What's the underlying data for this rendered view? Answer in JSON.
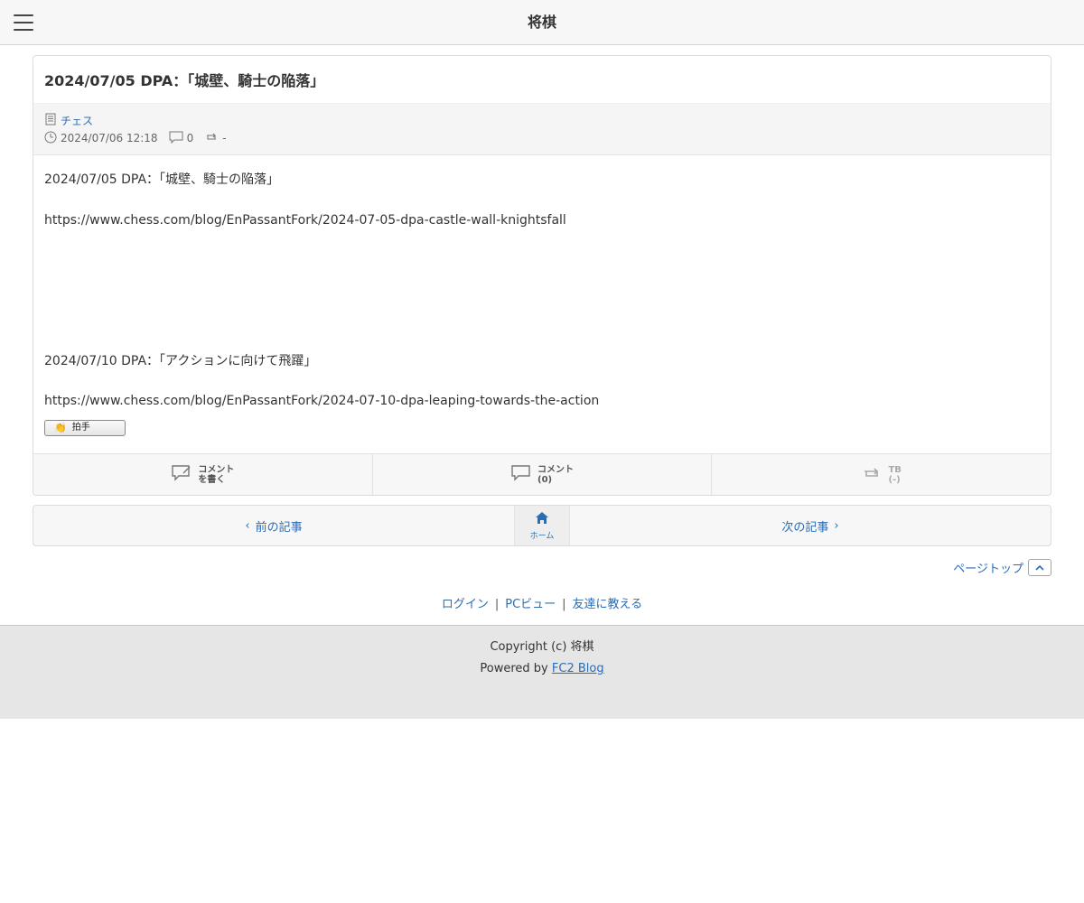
{
  "header": {
    "title": "将棋"
  },
  "entry": {
    "title": "2024/07/05 DPA：「城壁、騎士の陥落」",
    "category": "チェス",
    "datetime": "2024/07/06 12:18",
    "comment_count": "0",
    "trackback_count": "-",
    "paragraphs": [
      "2024/07/05 DPA：「城壁、騎士の陥落」",
      "https://www.chess.com/blog/EnPassantFork/2024-07-05-dpa-castle-wall-knightsfall",
      "2024/07/10 DPA：「アクションに向けて飛躍」",
      "https://www.chess.com/blog/EnPassantFork/2024-07-10-dpa-leaping-towards-the-action"
    ],
    "clap_label": "拍手"
  },
  "actions": {
    "write_comment_line1": "コメント",
    "write_comment_line2": "を書く",
    "comments_line1": "コメント",
    "comments_line2": "(0)",
    "tb_line1": "TB",
    "tb_line2": "(-)"
  },
  "pager": {
    "prev": "前の記事",
    "home": "ホーム",
    "next": "次の記事"
  },
  "pagetop": "ページトップ",
  "links": {
    "login": "ログイン",
    "pcview": "PCビュー",
    "tell": "友達に教える",
    "sep": "|"
  },
  "footer": {
    "copyright": "Copyright (c) 将棋",
    "powered_prefix": "Powered by",
    "powered_link": "FC2 Blog"
  }
}
